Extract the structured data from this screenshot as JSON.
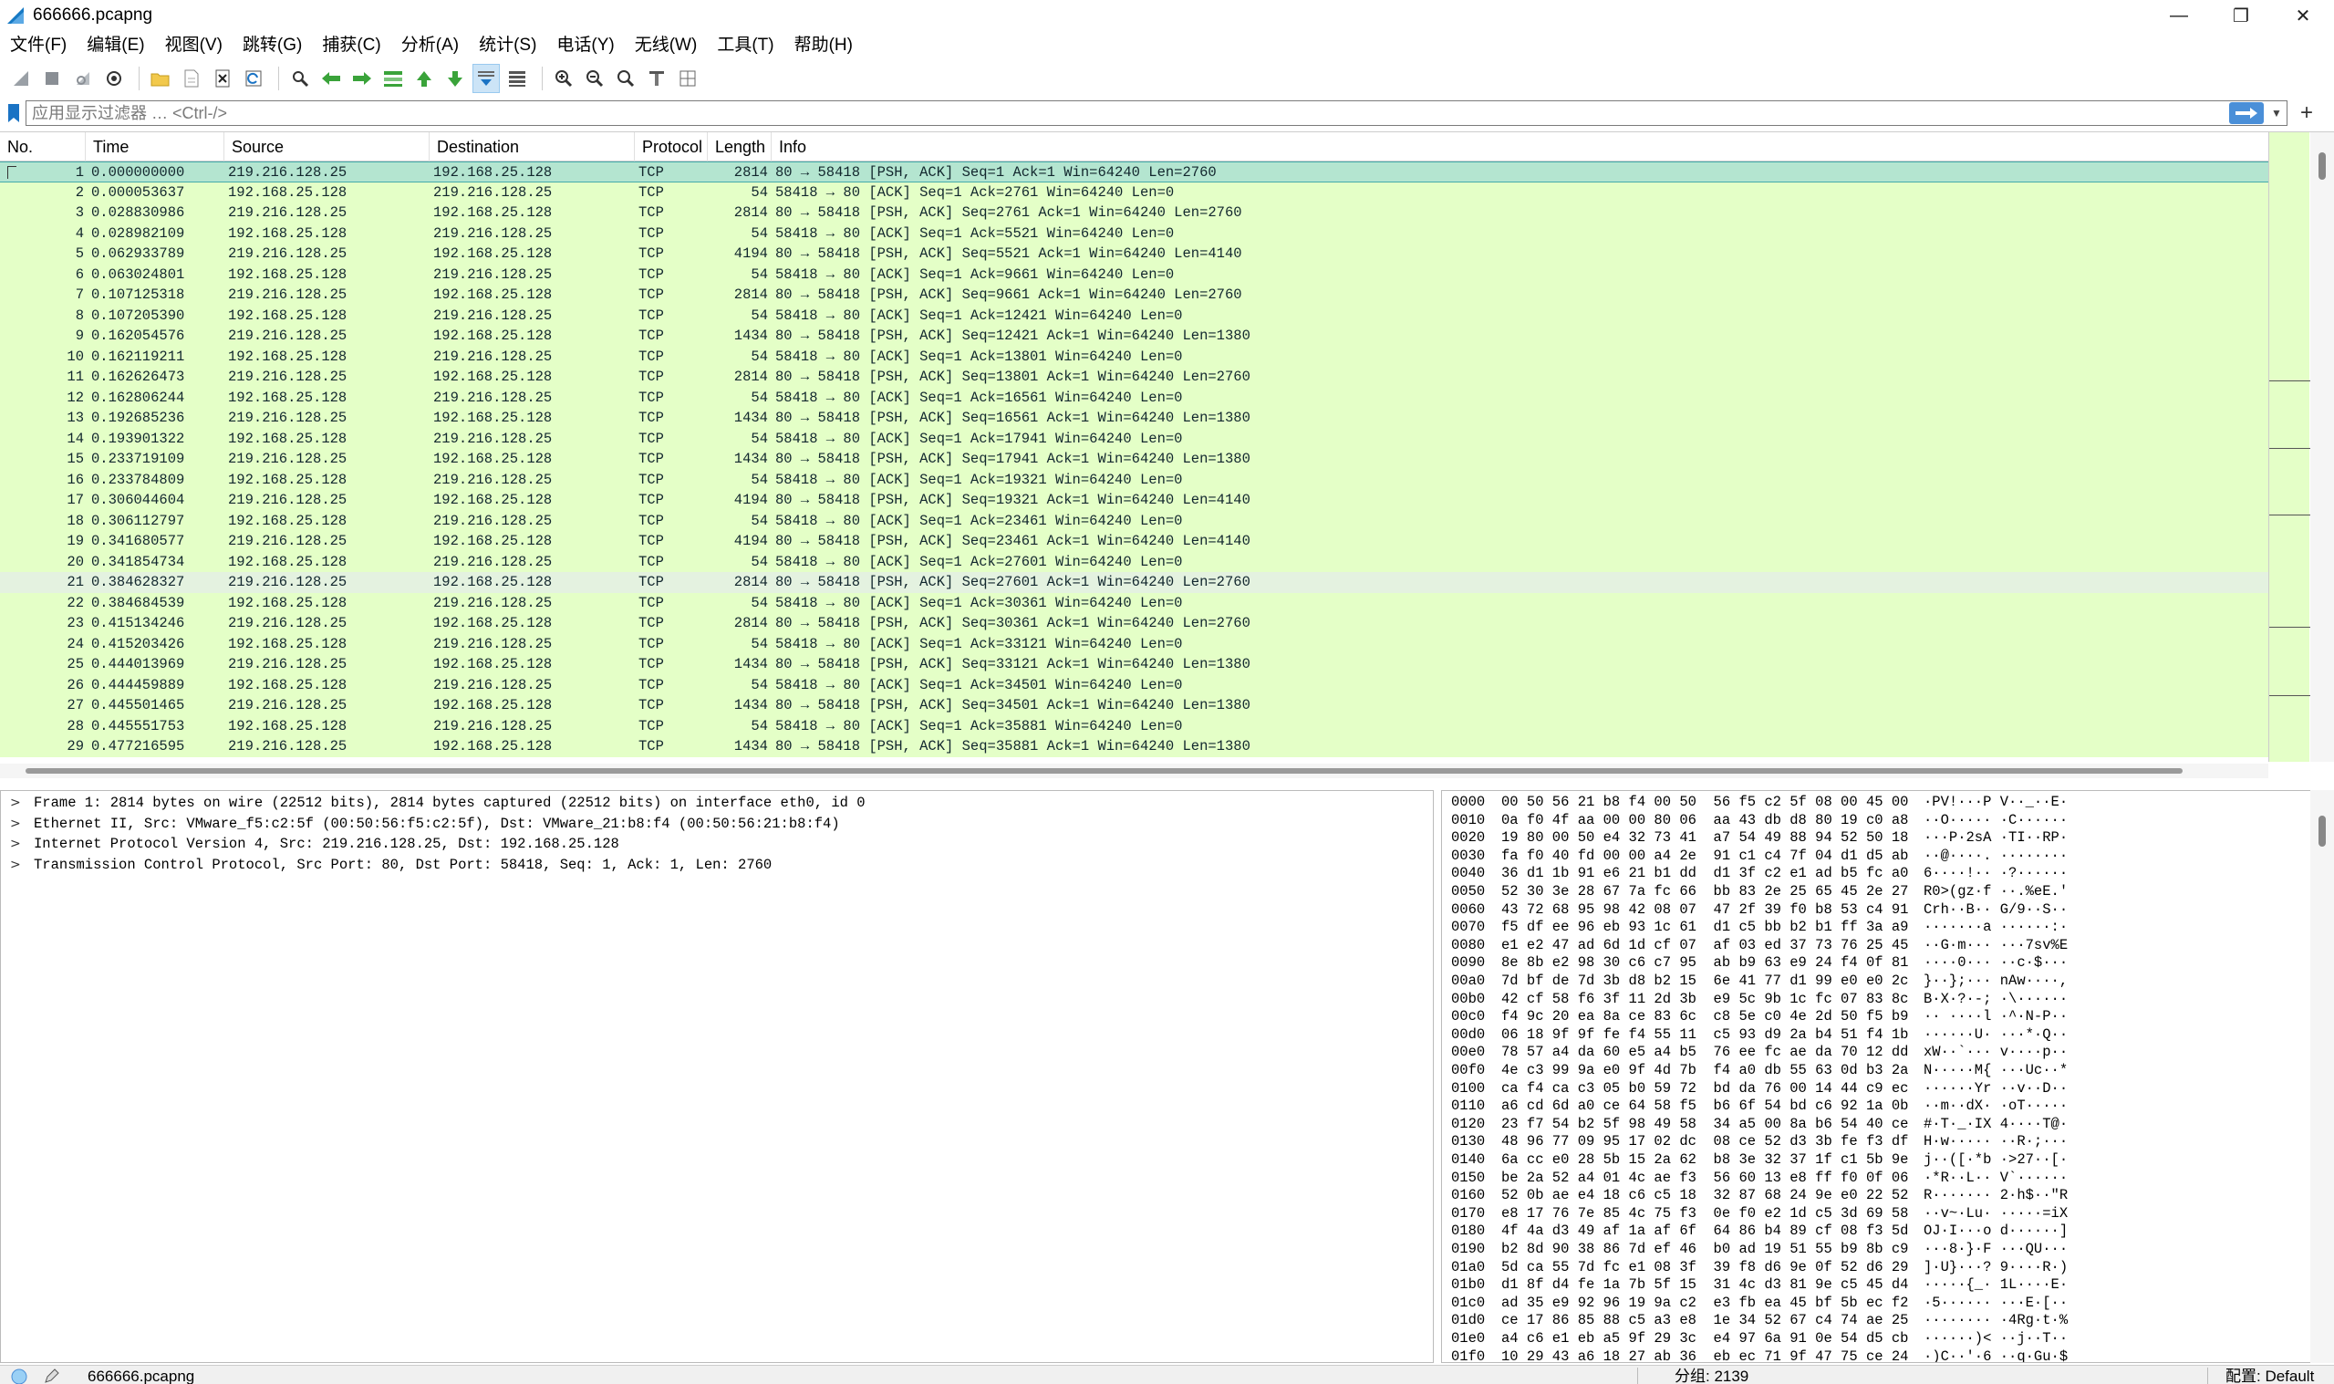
{
  "window": {
    "title": "666666.pcapng",
    "minimize_glyph": "—",
    "maximize_glyph": "❐",
    "close_glyph": "✕"
  },
  "menu": [
    "文件(F)",
    "编辑(E)",
    "视图(V)",
    "跳转(G)",
    "捕获(C)",
    "分析(A)",
    "统计(S)",
    "电话(Y)",
    "无线(W)",
    "工具(T)",
    "帮助(H)"
  ],
  "toolbar": {
    "icons": [
      "shark-fin-start-icon",
      "stop-icon",
      "restart-icon",
      "capture-options-icon",
      "open-folder-icon",
      "save-icon",
      "close-file-icon",
      "reload-icon",
      "find-icon",
      "go-back-icon",
      "go-forward-icon",
      "go-to-packet-icon",
      "first-packet-icon",
      "last-packet-icon",
      "autoscroll-icon",
      "colorize-icon",
      "zoom-in-icon",
      "zoom-out-icon",
      "normal-size-icon",
      "resize-columns-icon",
      "layout-icon"
    ]
  },
  "filter": {
    "placeholder": "应用显示过滤器 … <Ctrl-/>",
    "value": "",
    "add_button": "+"
  },
  "packet_list": {
    "columns": [
      "No.",
      "Time",
      "Source",
      "Destination",
      "Protocol",
      "Length",
      "Info"
    ],
    "rows": [
      {
        "no": "1",
        "time": "0.000000000",
        "src": "219.216.128.25",
        "dst": "192.168.25.128",
        "proto": "TCP",
        "len": "2814",
        "info": "80 → 58418 [PSH, ACK] Seq=1 Ack=1 Win=64240 Len=2760"
      },
      {
        "no": "2",
        "time": "0.000053637",
        "src": "192.168.25.128",
        "dst": "219.216.128.25",
        "proto": "TCP",
        "len": "54",
        "info": "58418 → 80 [ACK] Seq=1 Ack=2761 Win=64240 Len=0"
      },
      {
        "no": "3",
        "time": "0.028830986",
        "src": "219.216.128.25",
        "dst": "192.168.25.128",
        "proto": "TCP",
        "len": "2814",
        "info": "80 → 58418 [PSH, ACK] Seq=2761 Ack=1 Win=64240 Len=2760"
      },
      {
        "no": "4",
        "time": "0.028982109",
        "src": "192.168.25.128",
        "dst": "219.216.128.25",
        "proto": "TCP",
        "len": "54",
        "info": "58418 → 80 [ACK] Seq=1 Ack=5521 Win=64240 Len=0"
      },
      {
        "no": "5",
        "time": "0.062933789",
        "src": "219.216.128.25",
        "dst": "192.168.25.128",
        "proto": "TCP",
        "len": "4194",
        "info": "80 → 58418 [PSH, ACK] Seq=5521 Ack=1 Win=64240 Len=4140"
      },
      {
        "no": "6",
        "time": "0.063024801",
        "src": "192.168.25.128",
        "dst": "219.216.128.25",
        "proto": "TCP",
        "len": "54",
        "info": "58418 → 80 [ACK] Seq=1 Ack=9661 Win=64240 Len=0"
      },
      {
        "no": "7",
        "time": "0.107125318",
        "src": "219.216.128.25",
        "dst": "192.168.25.128",
        "proto": "TCP",
        "len": "2814",
        "info": "80 → 58418 [PSH, ACK] Seq=9661 Ack=1 Win=64240 Len=2760"
      },
      {
        "no": "8",
        "time": "0.107205390",
        "src": "192.168.25.128",
        "dst": "219.216.128.25",
        "proto": "TCP",
        "len": "54",
        "info": "58418 → 80 [ACK] Seq=1 Ack=12421 Win=64240 Len=0"
      },
      {
        "no": "9",
        "time": "0.162054576",
        "src": "219.216.128.25",
        "dst": "192.168.25.128",
        "proto": "TCP",
        "len": "1434",
        "info": "80 → 58418 [PSH, ACK] Seq=12421 Ack=1 Win=64240 Len=1380"
      },
      {
        "no": "10",
        "time": "0.162119211",
        "src": "192.168.25.128",
        "dst": "219.216.128.25",
        "proto": "TCP",
        "len": "54",
        "info": "58418 → 80 [ACK] Seq=1 Ack=13801 Win=64240 Len=0"
      },
      {
        "no": "11",
        "time": "0.162626473",
        "src": "219.216.128.25",
        "dst": "192.168.25.128",
        "proto": "TCP",
        "len": "2814",
        "info": "80 → 58418 [PSH, ACK] Seq=13801 Ack=1 Win=64240 Len=2760"
      },
      {
        "no": "12",
        "time": "0.162806244",
        "src": "192.168.25.128",
        "dst": "219.216.128.25",
        "proto": "TCP",
        "len": "54",
        "info": "58418 → 80 [ACK] Seq=1 Ack=16561 Win=64240 Len=0"
      },
      {
        "no": "13",
        "time": "0.192685236",
        "src": "219.216.128.25",
        "dst": "192.168.25.128",
        "proto": "TCP",
        "len": "1434",
        "info": "80 → 58418 [PSH, ACK] Seq=16561 Ack=1 Win=64240 Len=1380"
      },
      {
        "no": "14",
        "time": "0.193901322",
        "src": "192.168.25.128",
        "dst": "219.216.128.25",
        "proto": "TCP",
        "len": "54",
        "info": "58418 → 80 [ACK] Seq=1 Ack=17941 Win=64240 Len=0"
      },
      {
        "no": "15",
        "time": "0.233719109",
        "src": "219.216.128.25",
        "dst": "192.168.25.128",
        "proto": "TCP",
        "len": "1434",
        "info": "80 → 58418 [PSH, ACK] Seq=17941 Ack=1 Win=64240 Len=1380"
      },
      {
        "no": "16",
        "time": "0.233784809",
        "src": "192.168.25.128",
        "dst": "219.216.128.25",
        "proto": "TCP",
        "len": "54",
        "info": "58418 → 80 [ACK] Seq=1 Ack=19321 Win=64240 Len=0"
      },
      {
        "no": "17",
        "time": "0.306044604",
        "src": "219.216.128.25",
        "dst": "192.168.25.128",
        "proto": "TCP",
        "len": "4194",
        "info": "80 → 58418 [PSH, ACK] Seq=19321 Ack=1 Win=64240 Len=4140"
      },
      {
        "no": "18",
        "time": "0.306112797",
        "src": "192.168.25.128",
        "dst": "219.216.128.25",
        "proto": "TCP",
        "len": "54",
        "info": "58418 → 80 [ACK] Seq=1 Ack=23461 Win=64240 Len=0"
      },
      {
        "no": "19",
        "time": "0.341680577",
        "src": "219.216.128.25",
        "dst": "192.168.25.128",
        "proto": "TCP",
        "len": "4194",
        "info": "80 → 58418 [PSH, ACK] Seq=23461 Ack=1 Win=64240 Len=4140"
      },
      {
        "no": "20",
        "time": "0.341854734",
        "src": "192.168.25.128",
        "dst": "219.216.128.25",
        "proto": "TCP",
        "len": "54",
        "info": "58418 → 80 [ACK] Seq=1 Ack=27601 Win=64240 Len=0"
      },
      {
        "no": "21",
        "time": "0.384628327",
        "src": "219.216.128.25",
        "dst": "192.168.25.128",
        "proto": "TCP",
        "len": "2814",
        "info": "80 → 58418 [PSH, ACK] Seq=27601 Ack=1 Win=64240 Len=2760"
      },
      {
        "no": "22",
        "time": "0.384684539",
        "src": "192.168.25.128",
        "dst": "219.216.128.25",
        "proto": "TCP",
        "len": "54",
        "info": "58418 → 80 [ACK] Seq=1 Ack=30361 Win=64240 Len=0"
      },
      {
        "no": "23",
        "time": "0.415134246",
        "src": "219.216.128.25",
        "dst": "192.168.25.128",
        "proto": "TCP",
        "len": "2814",
        "info": "80 → 58418 [PSH, ACK] Seq=30361 Ack=1 Win=64240 Len=2760"
      },
      {
        "no": "24",
        "time": "0.415203426",
        "src": "192.168.25.128",
        "dst": "219.216.128.25",
        "proto": "TCP",
        "len": "54",
        "info": "58418 → 80 [ACK] Seq=1 Ack=33121 Win=64240 Len=0"
      },
      {
        "no": "25",
        "time": "0.444013969",
        "src": "219.216.128.25",
        "dst": "192.168.25.128",
        "proto": "TCP",
        "len": "1434",
        "info": "80 → 58418 [PSH, ACK] Seq=33121 Ack=1 Win=64240 Len=1380"
      },
      {
        "no": "26",
        "time": "0.444459889",
        "src": "192.168.25.128",
        "dst": "219.216.128.25",
        "proto": "TCP",
        "len": "54",
        "info": "58418 → 80 [ACK] Seq=1 Ack=34501 Win=64240 Len=0"
      },
      {
        "no": "27",
        "time": "0.445501465",
        "src": "219.216.128.25",
        "dst": "192.168.25.128",
        "proto": "TCP",
        "len": "1434",
        "info": "80 → 58418 [PSH, ACK] Seq=34501 Ack=1 Win=64240 Len=1380"
      },
      {
        "no": "28",
        "time": "0.445551753",
        "src": "192.168.25.128",
        "dst": "219.216.128.25",
        "proto": "TCP",
        "len": "54",
        "info": "58418 → 80 [ACK] Seq=1 Ack=35881 Win=64240 Len=0"
      },
      {
        "no": "29",
        "time": "0.477216595",
        "src": "219.216.128.25",
        "dst": "192.168.25.128",
        "proto": "TCP",
        "len": "1434",
        "info": "80 → 58418 [PSH, ACK] Seq=35881 Ack=1 Win=64240 Len=1380"
      }
    ]
  },
  "details": [
    "Frame 1: 2814 bytes on wire (22512 bits), 2814 bytes captured (22512 bits) on interface eth0, id 0",
    "Ethernet II, Src: VMware_f5:c2:5f (00:50:56:f5:c2:5f), Dst: VMware_21:b8:f4 (00:50:56:21:b8:f4)",
    "Internet Protocol Version 4, Src: 219.216.128.25, Dst: 192.168.25.128",
    "Transmission Control Protocol, Src Port: 80, Dst Port: 58418, Seq: 1, Ack: 1, Len: 2760"
  ],
  "bytes": [
    {
      "off": "0000",
      "hex": "00 50 56 21 b8 f4 00 50  56 f5 c2 5f 08 00 45 00",
      "asc": "·PV!···P V··_··E·"
    },
    {
      "off": "0010",
      "hex": "0a f0 4f aa 00 00 80 06  aa 43 db d8 80 19 c0 a8",
      "asc": "··O····· ·C······"
    },
    {
      "off": "0020",
      "hex": "19 80 00 50 e4 32 73 41  a7 54 49 88 94 52 50 18",
      "asc": "···P·2sA ·TI··RP·"
    },
    {
      "off": "0030",
      "hex": "fa f0 40 fd 00 00 a4 2e  91 c1 c4 7f 04 d1 d5 ab",
      "asc": "··@····. ········"
    },
    {
      "off": "0040",
      "hex": "36 d1 1b 91 e6 21 b1 dd  d1 3f c2 e1 ad b5 fc a0",
      "asc": "6····!·· ·?······"
    },
    {
      "off": "0050",
      "hex": "52 30 3e 28 67 7a fc 66  bb 83 2e 25 65 45 2e 27",
      "asc": "R0>(gz·f ··.%eE.'"
    },
    {
      "off": "0060",
      "hex": "43 72 68 95 98 42 08 07  47 2f 39 f0 b8 53 c4 91",
      "asc": "Crh··B·· G/9··S··"
    },
    {
      "off": "0070",
      "hex": "f5 df ee 96 eb 93 1c 61  d1 c5 bb b2 b1 ff 3a a9",
      "asc": "·······a ······:·"
    },
    {
      "off": "0080",
      "hex": "e1 e2 47 ad 6d 1d cf 07  af 03 ed 37 73 76 25 45",
      "asc": "··G·m··· ···7sv%E"
    },
    {
      "off": "0090",
      "hex": "8e 8b e2 98 30 c6 c7 95  ab b9 63 e9 24 f4 0f 81",
      "asc": "····0··· ··c·$···"
    },
    {
      "off": "00a0",
      "hex": "7d bf de 7d 3b d8 b2 15  6e 41 77 d1 99 e0 e0 2c",
      "asc": "}··};··· nAw····,"
    },
    {
      "off": "00b0",
      "hex": "42 cf 58 f6 3f 11 2d 3b  e9 5c 9b 1c fc 07 83 8c",
      "asc": "B·X·?·-; ·\\······"
    },
    {
      "off": "00c0",
      "hex": "f4 9c 20 ea 8a ce 83 6c  c8 5e c0 4e 2d 50 f5 b9",
      "asc": "·· ····l ·^·N-P··"
    },
    {
      "off": "00d0",
      "hex": "06 18 9f 9f fe f4 55 11  c5 93 d9 2a b4 51 f4 1b",
      "asc": "······U· ···*·Q··"
    },
    {
      "off": "00e0",
      "hex": "78 57 a4 da 60 e5 a4 b5  76 ee fc ae da 70 12 dd",
      "asc": "xW··`··· v····p··"
    },
    {
      "off": "00f0",
      "hex": "4e c3 99 9a e0 9f 4d 7b  f4 a0 db 55 63 0d b3 2a",
      "asc": "N·····M{ ···Uc··*"
    },
    {
      "off": "0100",
      "hex": "ca f4 ca c3 05 b0 59 72  bd da 76 00 14 44 c9 ec",
      "asc": "······Yr ··v··D··"
    },
    {
      "off": "0110",
      "hex": "a6 cd 6d a0 ce 64 58 f5  b6 6f 54 bd c6 92 1a 0b",
      "asc": "··m··dX· ·oT·····"
    },
    {
      "off": "0120",
      "hex": "23 f7 54 b2 5f 98 49 58  34 a5 00 8a b6 54 40 ce",
      "asc": "#·T·_·IX 4····T@·"
    },
    {
      "off": "0130",
      "hex": "48 96 77 09 95 17 02 dc  08 ce 52 d3 3b fe f3 df",
      "asc": "H·w····· ··R·;···"
    },
    {
      "off": "0140",
      "hex": "6a cc e0 28 5b 15 2a 62  b8 3e 32 37 1f c1 5b 9e",
      "asc": "j··([·*b ·>27··[·"
    },
    {
      "off": "0150",
      "hex": "be 2a 52 a4 01 4c ae f3  56 60 13 e8 ff f0 0f 06",
      "asc": "·*R··L·· V`······"
    },
    {
      "off": "0160",
      "hex": "52 0b ae e4 18 c6 c5 18  32 87 68 24 9e e0 22 52",
      "asc": "R······· 2·h$··\"R"
    },
    {
      "off": "0170",
      "hex": "e8 17 76 7e 85 4c 75 f3  0e f0 e2 1d c5 3d 69 58",
      "asc": "··v~·Lu· ·····=iX"
    },
    {
      "off": "0180",
      "hex": "4f 4a d3 49 af 1a af 6f  64 86 b4 89 cf 08 f3 5d",
      "asc": "OJ·I···o d······]"
    },
    {
      "off": "0190",
      "hex": "b2 8d 90 38 86 7d ef 46  b0 ad 19 51 55 b9 8b c9",
      "asc": "···8·}·F ···QU···"
    },
    {
      "off": "01a0",
      "hex": "5d ca 55 7d fc e1 08 3f  39 f8 d6 9e 0f 52 d6 29",
      "asc": "]·U}···? 9····R·)"
    },
    {
      "off": "01b0",
      "hex": "d1 8f d4 fe 1a 7b 5f 15  31 4c d3 81 9e c5 45 d4",
      "asc": "·····{_· 1L····E·"
    },
    {
      "off": "01c0",
      "hex": "ad 35 e9 92 96 19 9a c2  e3 fb ea 45 bf 5b ec f2",
      "asc": "·5······ ···E·[··"
    },
    {
      "off": "01d0",
      "hex": "ce 17 86 85 88 c5 a3 e8  1e 34 52 67 c4 74 ae 25",
      "asc": "········ ·4Rg·t·%"
    },
    {
      "off": "01e0",
      "hex": "a4 c6 e1 eb a5 9f 29 3c  e4 97 6a 91 0e 54 d5 cb",
      "asc": "······)< ··j··T··"
    },
    {
      "off": "01f0",
      "hex": "10 29 43 a6 18 27 ab 36  eb ec 71 9f 47 75 ce 24",
      "asc": "·)C··'·6 ··q·Gu·$"
    }
  ],
  "status": {
    "file": "666666.pcapng",
    "packets": "分组: 2139",
    "profile": "配置: Default"
  },
  "colors": {
    "row_bg": "#e4ffc7",
    "row_selected": "#b4e5d0",
    "accent": "#4a8fd8"
  }
}
